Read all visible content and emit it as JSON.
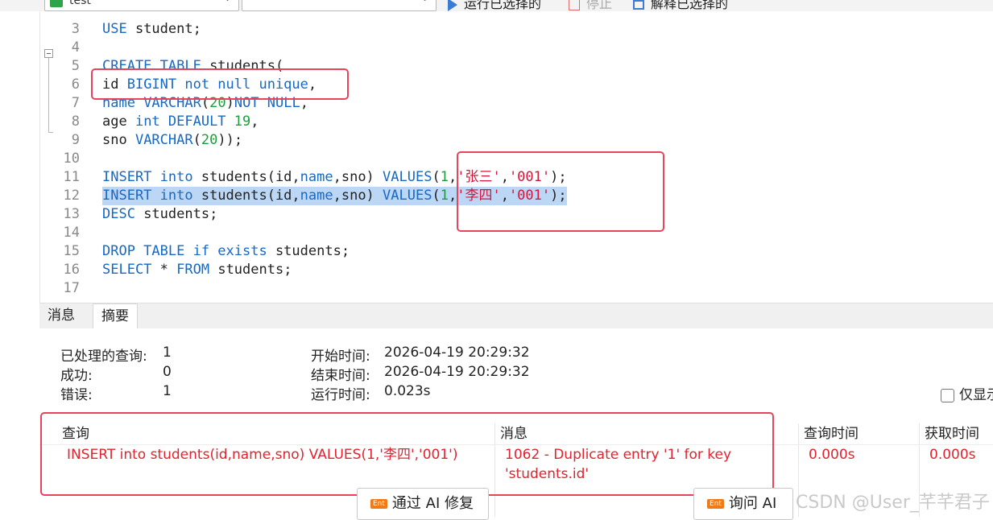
{
  "toolbar": {
    "connection_value": "test",
    "database_value": "",
    "run_selected_label": "运行已选择的",
    "stop_label": "停止",
    "explain_selected_label": "解释已选择的"
  },
  "editor": {
    "lines": [
      {
        "n": "3",
        "tokens": [
          {
            "t": "USE ",
            "c": "kw"
          },
          {
            "t": "student;",
            "c": "plain"
          }
        ]
      },
      {
        "n": "4",
        "tokens": []
      },
      {
        "n": "5",
        "tokens": [
          {
            "t": "CREATE TABLE ",
            "c": "kw"
          },
          {
            "t": "students(",
            "c": "plain"
          }
        ]
      },
      {
        "n": "6",
        "tokens": [
          {
            "t": "id ",
            "c": "plain"
          },
          {
            "t": "BIGINT not null unique",
            "c": "kw"
          },
          {
            "t": ",",
            "c": "plain"
          }
        ]
      },
      {
        "n": "7",
        "tokens": [
          {
            "t": "name ",
            "c": "kw"
          },
          {
            "t": "VARCHAR",
            "c": "kw"
          },
          {
            "t": "(",
            "c": "plain"
          },
          {
            "t": "20",
            "c": "num"
          },
          {
            "t": ")",
            "c": "plain"
          },
          {
            "t": "NOT NULL",
            "c": "kw"
          },
          {
            "t": ",",
            "c": "plain"
          }
        ]
      },
      {
        "n": "8",
        "tokens": [
          {
            "t": "age ",
            "c": "plain"
          },
          {
            "t": "int DEFAULT ",
            "c": "kw"
          },
          {
            "t": "19",
            "c": "num"
          },
          {
            "t": ",",
            "c": "plain"
          }
        ]
      },
      {
        "n": "9",
        "tokens": [
          {
            "t": "sno ",
            "c": "plain"
          },
          {
            "t": "VARCHAR",
            "c": "kw"
          },
          {
            "t": "(",
            "c": "plain"
          },
          {
            "t": "20",
            "c": "num"
          },
          {
            "t": "));",
            "c": "plain"
          }
        ]
      },
      {
        "n": "10",
        "tokens": []
      },
      {
        "n": "11",
        "tokens": [
          {
            "t": "INSERT into ",
            "c": "kw"
          },
          {
            "t": "students(id,",
            "c": "plain"
          },
          {
            "t": "name",
            "c": "kw"
          },
          {
            "t": ",sno) ",
            "c": "plain"
          },
          {
            "t": "VALUES",
            "c": "kw"
          },
          {
            "t": "(",
            "c": "plain"
          },
          {
            "t": "1",
            "c": "num"
          },
          {
            "t": ",",
            "c": "plain"
          },
          {
            "t": "'张三'",
            "c": "str"
          },
          {
            "t": ",",
            "c": "plain"
          },
          {
            "t": "'001'",
            "c": "str"
          },
          {
            "t": ");",
            "c": "plain"
          }
        ]
      },
      {
        "n": "12",
        "highlight": true,
        "tokens": [
          {
            "t": "INSERT into ",
            "c": "kw"
          },
          {
            "t": "students(id,",
            "c": "plain"
          },
          {
            "t": "name",
            "c": "kw"
          },
          {
            "t": ",sno) ",
            "c": "plain"
          },
          {
            "t": "VALUES",
            "c": "kw"
          },
          {
            "t": "(",
            "c": "plain"
          },
          {
            "t": "1",
            "c": "num"
          },
          {
            "t": ",",
            "c": "plain"
          },
          {
            "t": "'李四'",
            "c": "str"
          },
          {
            "t": ",",
            "c": "plain"
          },
          {
            "t": "'001'",
            "c": "str"
          },
          {
            "t": ");",
            "c": "plain"
          }
        ]
      },
      {
        "n": "13",
        "tokens": [
          {
            "t": "DESC ",
            "c": "kw"
          },
          {
            "t": "students;",
            "c": "plain"
          }
        ]
      },
      {
        "n": "14",
        "tokens": []
      },
      {
        "n": "15",
        "tokens": [
          {
            "t": "DROP TABLE if exists ",
            "c": "kw"
          },
          {
            "t": "students;",
            "c": "plain"
          }
        ]
      },
      {
        "n": "16",
        "tokens": [
          {
            "t": "SELECT ",
            "c": "kw"
          },
          {
            "t": "* ",
            "c": "plain"
          },
          {
            "t": "FROM ",
            "c": "kw"
          },
          {
            "t": "students;",
            "c": "plain"
          }
        ]
      },
      {
        "n": "17",
        "tokens": []
      }
    ]
  },
  "tabs": {
    "messages": "消息",
    "summary": "摘要"
  },
  "summary": {
    "processed_label": "已处理的查询:",
    "processed_value": "1",
    "success_label": "成功:",
    "success_value": "0",
    "error_label": "错误:",
    "error_value": "1",
    "start_label": "开始时间:",
    "start_value": "2026-04-19 20:29:32",
    "end_label": "结束时间:",
    "end_value": "2026-04-19 20:29:32",
    "run_label": "运行时间:",
    "run_value": "0.023s",
    "only_show_label": "仅显示"
  },
  "grid": {
    "headers": {
      "query": "查询",
      "message": "消息",
      "query_time": "查询时间",
      "fetch_time": "获取时间"
    },
    "row": {
      "query": "INSERT into students(id,name,sno) VALUES(1,'李四','001')",
      "message_line1": "1062 - Duplicate entry '1' for key",
      "message_line2": "'students.id'",
      "query_time": "0.000s",
      "fetch_time": "0.000s"
    }
  },
  "buttons": {
    "ai_fix": "通过 AI 修复",
    "ask_ai": "询问 AI",
    "badge": "Ent"
  },
  "watermark": "CSDN @User_芊芊君子",
  "colors": {
    "keyword": "#1769c6",
    "number": "#1a9e3d",
    "string": "#d6163a",
    "error": "#e0232f",
    "annotation": "#e8435a",
    "selection": "#bcd6f5"
  }
}
